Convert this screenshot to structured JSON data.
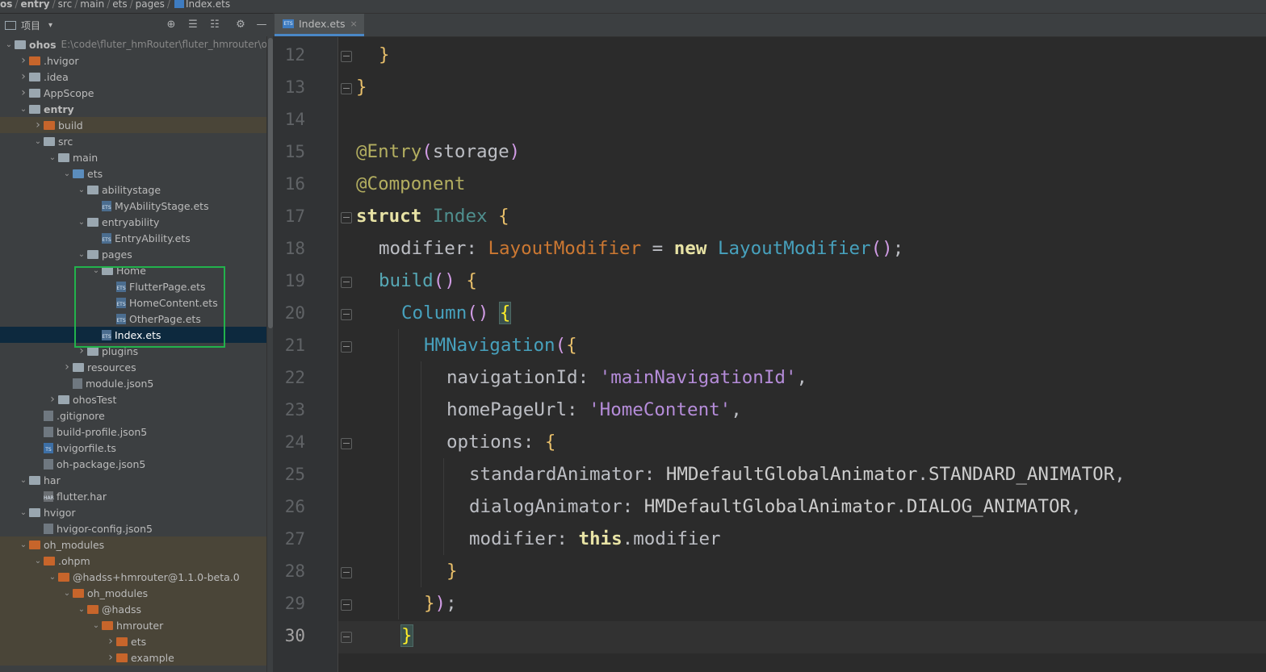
{
  "breadcrumb": [
    "os",
    "entry",
    "src",
    "main",
    "ets",
    "pages",
    "Index.ets"
  ],
  "project_toolbar": {
    "title": "项目",
    "icons": [
      "globe-target-icon",
      "collapse-all-icon",
      "expand-all-icon",
      "gear-icon",
      "minimize-icon"
    ]
  },
  "tree": [
    {
      "label": "ohos",
      "path": "E:\\code\\fluter_hmRouter\\fluter_hmrouter\\ohos",
      "arrow": "down",
      "icon": "module-folder",
      "indent": 0,
      "bold": true
    },
    {
      "label": ".hvigor",
      "arrow": "right",
      "icon": "orange-folder",
      "indent": 1
    },
    {
      "label": ".idea",
      "arrow": "right",
      "icon": "folder",
      "indent": 1
    },
    {
      "label": "AppScope",
      "arrow": "right",
      "icon": "folder",
      "indent": 1
    },
    {
      "label": "entry",
      "arrow": "down",
      "icon": "module-folder",
      "indent": 1,
      "bold": true
    },
    {
      "label": "build",
      "arrow": "right",
      "icon": "orange-folder",
      "indent": 2,
      "row_style": "tint"
    },
    {
      "label": "src",
      "arrow": "down",
      "icon": "folder",
      "indent": 2
    },
    {
      "label": "main",
      "arrow": "down",
      "icon": "folder",
      "indent": 3
    },
    {
      "label": "ets",
      "arrow": "down",
      "icon": "blue-folder",
      "indent": 4
    },
    {
      "label": "abilitystage",
      "arrow": "down",
      "icon": "folder",
      "indent": 5
    },
    {
      "label": "MyAbilityStage.ets",
      "arrow": "none",
      "icon": "ets-file",
      "indent": 6
    },
    {
      "label": "entryability",
      "arrow": "down",
      "icon": "folder",
      "indent": 5
    },
    {
      "label": "EntryAbility.ets",
      "arrow": "none",
      "icon": "ets-file",
      "indent": 6
    },
    {
      "label": "pages",
      "arrow": "down",
      "icon": "folder",
      "indent": 5
    },
    {
      "label": "Home",
      "arrow": "down",
      "icon": "folder",
      "indent": 6
    },
    {
      "label": "FlutterPage.ets",
      "arrow": "none",
      "icon": "ets-file",
      "indent": 7
    },
    {
      "label": "HomeContent.ets",
      "arrow": "none",
      "icon": "ets-file",
      "indent": 7
    },
    {
      "label": "OtherPage.ets",
      "arrow": "none",
      "icon": "ets-file",
      "indent": 7
    },
    {
      "label": "Index.ets",
      "arrow": "none",
      "icon": "ets-file",
      "indent": 6,
      "row_style": "sel"
    },
    {
      "label": "plugins",
      "arrow": "right",
      "icon": "folder",
      "indent": 5
    },
    {
      "label": "resources",
      "arrow": "right",
      "icon": "folder",
      "indent": 4
    },
    {
      "label": "module.json5",
      "arrow": "none",
      "icon": "json-file",
      "indent": 4
    },
    {
      "label": "ohosTest",
      "arrow": "right",
      "icon": "folder",
      "indent": 3
    },
    {
      "label": ".gitignore",
      "arrow": "none",
      "icon": "json-file",
      "indent": 2
    },
    {
      "label": "build-profile.json5",
      "arrow": "none",
      "icon": "json-file",
      "indent": 2
    },
    {
      "label": "hvigorfile.ts",
      "arrow": "none",
      "icon": "ts-file",
      "indent": 2
    },
    {
      "label": "oh-package.json5",
      "arrow": "none",
      "icon": "json-file",
      "indent": 2
    },
    {
      "label": "har",
      "arrow": "down",
      "icon": "folder",
      "indent": 1
    },
    {
      "label": "flutter.har",
      "arrow": "none",
      "icon": "har-file",
      "indent": 2
    },
    {
      "label": "hvigor",
      "arrow": "down",
      "icon": "folder",
      "indent": 1
    },
    {
      "label": "hvigor-config.json5",
      "arrow": "none",
      "icon": "json-file",
      "indent": 2
    },
    {
      "label": "oh_modules",
      "arrow": "down",
      "icon": "orange-folder",
      "indent": 1,
      "row_style": "tint"
    },
    {
      "label": ".ohpm",
      "arrow": "down",
      "icon": "orange-folder",
      "indent": 2,
      "row_style": "tint"
    },
    {
      "label": "@hadss+hmrouter@1.1.0-beta.0",
      "arrow": "down",
      "icon": "orange-folder",
      "indent": 3,
      "row_style": "tint"
    },
    {
      "label": "oh_modules",
      "arrow": "down",
      "icon": "orange-folder",
      "indent": 4,
      "row_style": "tint"
    },
    {
      "label": "@hadss",
      "arrow": "down",
      "icon": "orange-folder",
      "indent": 5,
      "row_style": "tint"
    },
    {
      "label": "hmrouter",
      "arrow": "down",
      "icon": "orange-folder",
      "indent": 6,
      "row_style": "tint"
    },
    {
      "label": "ets",
      "arrow": "right",
      "icon": "orange-folder",
      "indent": 7,
      "row_style": "tint"
    },
    {
      "label": "example",
      "arrow": "right",
      "icon": "orange-folder",
      "indent": 7,
      "row_style": "tint"
    }
  ],
  "editor_tab": {
    "label": "Index.ets",
    "close": "×"
  },
  "editor": {
    "current_line": "30",
    "lines": [
      {
        "n": "12",
        "indent": 1,
        "fold": true,
        "tokens": [
          [
            "}",
            "brace"
          ]
        ]
      },
      {
        "n": "13",
        "indent": 0,
        "fold": true,
        "tokens": [
          [
            "}",
            "brace"
          ]
        ]
      },
      {
        "n": "14",
        "indent": 0,
        "fold": false,
        "tokens": []
      },
      {
        "n": "15",
        "indent": 0,
        "fold": false,
        "tokens": [
          [
            "@Entry",
            "dec"
          ],
          [
            "(",
            "brace2"
          ],
          [
            "storage",
            "prop"
          ],
          [
            ")",
            "brace2"
          ]
        ]
      },
      {
        "n": "16",
        "indent": 0,
        "fold": false,
        "tokens": [
          [
            "@Component",
            "dec"
          ]
        ]
      },
      {
        "n": "17",
        "indent": 0,
        "fold": true,
        "tokens": [
          [
            "struct",
            "kw2"
          ],
          [
            " ",
            "prop"
          ],
          [
            "Index",
            "type2"
          ],
          [
            " ",
            "prop"
          ],
          [
            "{",
            "brace"
          ]
        ]
      },
      {
        "n": "18",
        "indent": 1,
        "fold": false,
        "tokens": [
          [
            "modifier",
            "prop"
          ],
          [
            ": ",
            "prop"
          ],
          [
            "LayoutModifier",
            "typeo"
          ],
          [
            " = ",
            "prop"
          ],
          [
            "new",
            "kw2"
          ],
          [
            " ",
            "prop"
          ],
          [
            "LayoutModifier",
            "class"
          ],
          [
            "()",
            "brace2"
          ],
          [
            ";",
            "prop"
          ]
        ]
      },
      {
        "n": "19",
        "indent": 1,
        "fold": true,
        "tokens": [
          [
            "build",
            "func"
          ],
          [
            "()",
            "brace2"
          ],
          [
            " ",
            "prop"
          ],
          [
            "{",
            "brace"
          ]
        ]
      },
      {
        "n": "20",
        "indent": 2,
        "fold": true,
        "tokens": [
          [
            "Column",
            "class"
          ],
          [
            "()",
            "brace2"
          ],
          [
            " ",
            "prop"
          ],
          [
            "{",
            "bh"
          ]
        ]
      },
      {
        "n": "21",
        "indent": 3,
        "fold": true,
        "tokens": [
          [
            "HMNavigation",
            "class"
          ],
          [
            "(",
            "brace2"
          ],
          [
            "{",
            "brace"
          ]
        ]
      },
      {
        "n": "22",
        "indent": 4,
        "fold": false,
        "tokens": [
          [
            "navigationId",
            "prop"
          ],
          [
            ": ",
            "prop"
          ],
          [
            "'mainNavigationId'",
            "str"
          ],
          [
            ",",
            "prop"
          ]
        ]
      },
      {
        "n": "23",
        "indent": 4,
        "fold": false,
        "tokens": [
          [
            "homePageUrl",
            "prop"
          ],
          [
            ": ",
            "prop"
          ],
          [
            "'HomeContent'",
            "str"
          ],
          [
            ",",
            "prop"
          ]
        ]
      },
      {
        "n": "24",
        "indent": 4,
        "fold": true,
        "tokens": [
          [
            "options",
            "prop"
          ],
          [
            ": ",
            "prop"
          ],
          [
            "{",
            "brace"
          ]
        ]
      },
      {
        "n": "25",
        "indent": 5,
        "fold": false,
        "tokens": [
          [
            "standardAnimator",
            "prop"
          ],
          [
            ": ",
            "prop"
          ],
          [
            "HMDefaultGlobalAnimator",
            "const"
          ],
          [
            ".",
            "prop"
          ],
          [
            "STANDARD_ANIMATOR",
            "const"
          ],
          [
            ",",
            "prop"
          ]
        ]
      },
      {
        "n": "26",
        "indent": 5,
        "fold": false,
        "tokens": [
          [
            "dialogAnimator",
            "prop"
          ],
          [
            ": ",
            "prop"
          ],
          [
            "HMDefaultGlobalAnimator",
            "const"
          ],
          [
            ".",
            "prop"
          ],
          [
            "DIALOG_ANIMATOR",
            "const"
          ],
          [
            ",",
            "prop"
          ]
        ]
      },
      {
        "n": "27",
        "indent": 5,
        "fold": false,
        "tokens": [
          [
            "modifier",
            "prop"
          ],
          [
            ": ",
            "prop"
          ],
          [
            "this",
            "kw2"
          ],
          [
            ".",
            "prop"
          ],
          [
            "modifier",
            "prop"
          ]
        ]
      },
      {
        "n": "28",
        "indent": 4,
        "fold": true,
        "tokens": [
          [
            "}",
            "brace"
          ]
        ]
      },
      {
        "n": "29",
        "indent": 3,
        "fold": true,
        "tokens": [
          [
            "}",
            "brace"
          ],
          [
            ")",
            "brace2"
          ],
          [
            ";",
            "prop"
          ]
        ]
      },
      {
        "n": "30",
        "indent": 2,
        "fold": true,
        "tokens": [
          [
            "}",
            "bh"
          ]
        ]
      }
    ]
  }
}
